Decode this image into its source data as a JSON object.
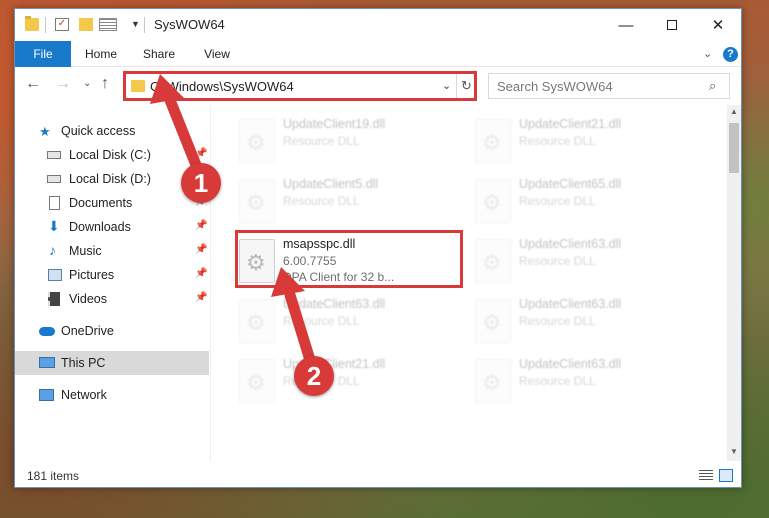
{
  "window": {
    "title": "SysWOW64",
    "minimize_glyph": "—",
    "close_glyph": "✕"
  },
  "ribbon": {
    "tabs": [
      "File",
      "Home",
      "Share",
      "View"
    ]
  },
  "navbar": {
    "address": "C:\\Windows\\SysWOW64",
    "search_placeholder": "Search SysWOW64"
  },
  "sidebar": {
    "items": [
      {
        "label": "Quick access",
        "icon": "star-icon",
        "pinned": false
      },
      {
        "label": "Local Disk (C:)",
        "icon": "drive-icon",
        "pinned": true
      },
      {
        "label": "Local Disk (D:)",
        "icon": "drive-icon",
        "pinned": false
      },
      {
        "label": "Documents",
        "icon": "document-icon",
        "pinned": true
      },
      {
        "label": "Downloads",
        "icon": "download-icon",
        "pinned": true
      },
      {
        "label": "Music",
        "icon": "music-icon",
        "pinned": true
      },
      {
        "label": "Pictures",
        "icon": "picture-icon",
        "pinned": true
      },
      {
        "label": "Videos",
        "icon": "video-icon",
        "pinned": true
      },
      {
        "label": "OneDrive",
        "icon": "cloud-icon",
        "pinned": false
      },
      {
        "label": "This PC",
        "icon": "computer-icon",
        "pinned": false,
        "selected": true
      },
      {
        "label": "Network",
        "icon": "network-icon",
        "pinned": false
      }
    ]
  },
  "files": [
    {
      "name": "UpdateClient19.dll",
      "line1": "Resource DLL",
      "line2": ""
    },
    {
      "name": "UpdateClient21.dll",
      "line1": "Resource DLL",
      "line2": ""
    },
    {
      "name": "UpdateClient5.dll",
      "line1": "Resource DLL",
      "line2": ""
    },
    {
      "name": "UpdateClient65.dll",
      "line1": "Resource DLL",
      "line2": ""
    },
    {
      "name": "msapsspc.dll",
      "line1": "6.00.7755",
      "line2": "DPA Client for 32 b..."
    },
    {
      "name": "UpdateClient63.dll",
      "line1": "Resource DLL",
      "line2": ""
    },
    {
      "name": "UpdateClient63.dll",
      "line1": "Resource DLL",
      "line2": ""
    },
    {
      "name": "UpdateClient63.dll",
      "line1": "Resource DLL",
      "line2": ""
    },
    {
      "name": "UpdateClient21.dll",
      "line1": "Resource DLL",
      "line2": ""
    },
    {
      "name": "UpdateClient63.dll",
      "line1": "Resource DLL",
      "line2": ""
    }
  ],
  "status": {
    "item_count": "181 items"
  },
  "annotations": {
    "step1": "1",
    "step2": "2",
    "color": "#d83a3a"
  }
}
